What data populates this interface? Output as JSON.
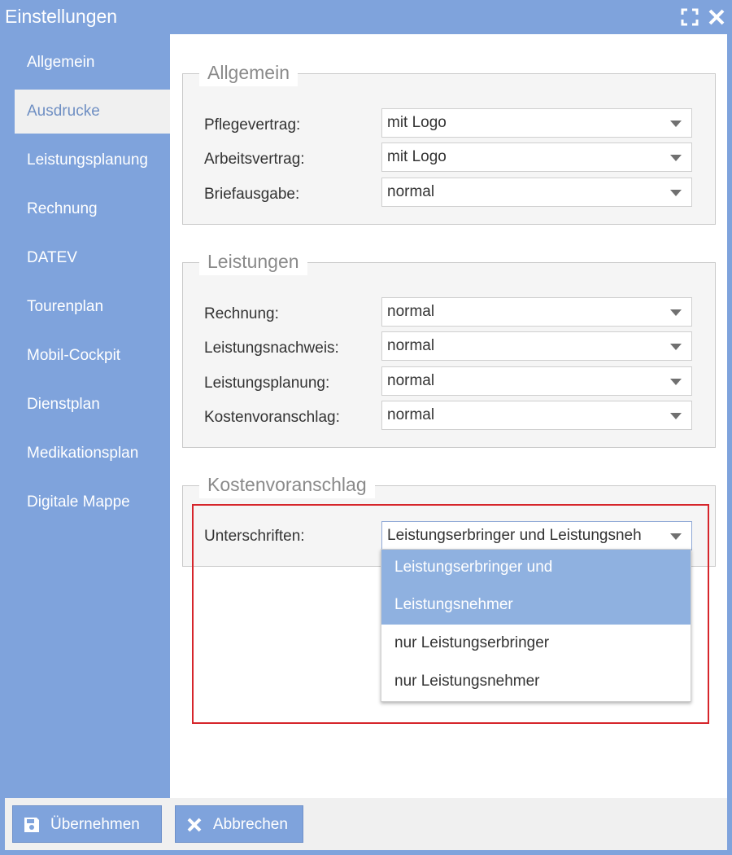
{
  "window": {
    "title": "Einstellungen"
  },
  "sidebar": {
    "items": [
      {
        "label": "Allgemein"
      },
      {
        "label": "Ausdrucke",
        "active": true
      },
      {
        "label": "Leistungsplanung"
      },
      {
        "label": "Rechnung"
      },
      {
        "label": "DATEV"
      },
      {
        "label": "Tourenplan"
      },
      {
        "label": "Mobil-Cockpit"
      },
      {
        "label": "Dienstplan"
      },
      {
        "label": "Medikationsplan"
      },
      {
        "label": "Digitale Mappe"
      }
    ]
  },
  "sections": {
    "allgemein": {
      "legend": "Allgemein",
      "rows": [
        {
          "label": "Pflegevertrag:",
          "value": "mit Logo"
        },
        {
          "label": "Arbeitsvertrag:",
          "value": "mit Logo"
        },
        {
          "label": "Briefausgabe:",
          "value": "normal"
        }
      ]
    },
    "leistungen": {
      "legend": "Leistungen",
      "rows": [
        {
          "label": "Rechnung:",
          "value": "normal"
        },
        {
          "label": "Leistungsnachweis:",
          "value": "normal"
        },
        {
          "label": "Leistungsplanung:",
          "value": "normal"
        },
        {
          "label": "Kostenvoranschlag:",
          "value": "normal"
        }
      ]
    },
    "kostenvoranschlag": {
      "legend": "Kostenvoranschlag",
      "rows": [
        {
          "label": "Unterschriften:",
          "value": "Leistungserbringer und Leistungsneh"
        }
      ],
      "dropdown_options": [
        {
          "line1": "Leistungserbringer und",
          "line2": "Leistungsnehmer",
          "selected": true
        },
        {
          "line1": "nur Leistungserbringer"
        },
        {
          "line1": "nur Leistungsnehmer"
        }
      ]
    }
  },
  "footer": {
    "apply_label": "Übernehmen",
    "cancel_label": "Abbrechen"
  },
  "colors": {
    "accent": "#7fa3dc",
    "selected_option": "#8fb1e0",
    "highlight": "#d6252b"
  },
  "icons": [
    "maximize-icon",
    "close-icon",
    "floppy-disk-icon",
    "cancel-x-icon",
    "dropdown-caret-icon"
  ]
}
